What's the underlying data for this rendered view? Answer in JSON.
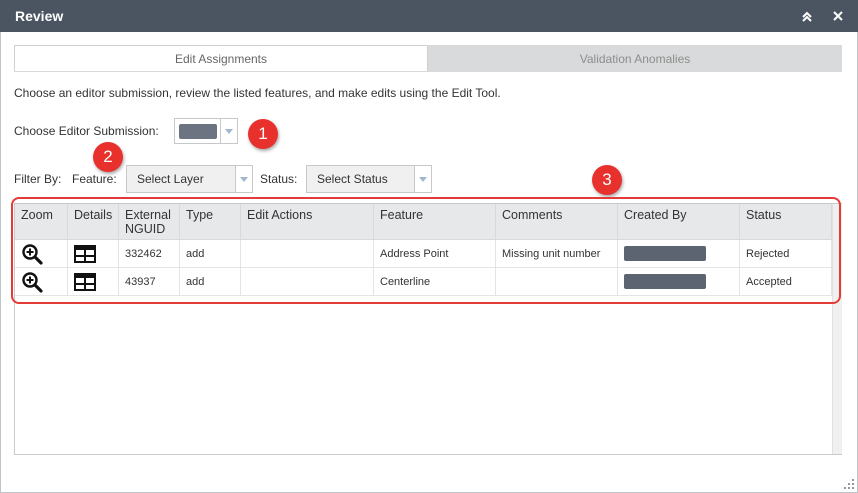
{
  "window": {
    "title": "Review",
    "collapse_icon": "double-chevron-up-icon",
    "close_icon": "close-icon"
  },
  "tabs": [
    {
      "label": "Edit Assignments",
      "active": true
    },
    {
      "label": "Validation Anomalies",
      "active": false
    }
  ],
  "instructions": "Choose an editor submission, review the listed features, and make edits using the Edit Tool.",
  "submission": {
    "label": "Choose Editor Submission:",
    "value_redacted": true
  },
  "filter": {
    "label": "Filter By:",
    "feature_label": "Feature:",
    "feature_value": "Select Layer",
    "status_label": "Status:",
    "status_value": "Select Status"
  },
  "callouts": [
    "1",
    "2",
    "3"
  ],
  "table": {
    "columns": [
      "Zoom",
      "Details",
      "External NGUID",
      "Type",
      "Edit Actions",
      "Feature",
      "Comments",
      "Created By",
      "Status"
    ],
    "rows": [
      {
        "nguid": "332462",
        "type": "add",
        "edit_actions": "",
        "feature": "Address Point",
        "comments": "Missing unit number",
        "created_by_redacted": true,
        "status": "Rejected"
      },
      {
        "nguid": "43937",
        "type": "add",
        "edit_actions": "",
        "feature": "Centerline",
        "comments": "",
        "created_by_redacted": true,
        "status": "Accepted"
      }
    ]
  },
  "colors": {
    "titlebar": "#4b5561",
    "callout": "#e8302d",
    "header_bg": "#e6e8ea",
    "redaction": "#5b6470"
  }
}
